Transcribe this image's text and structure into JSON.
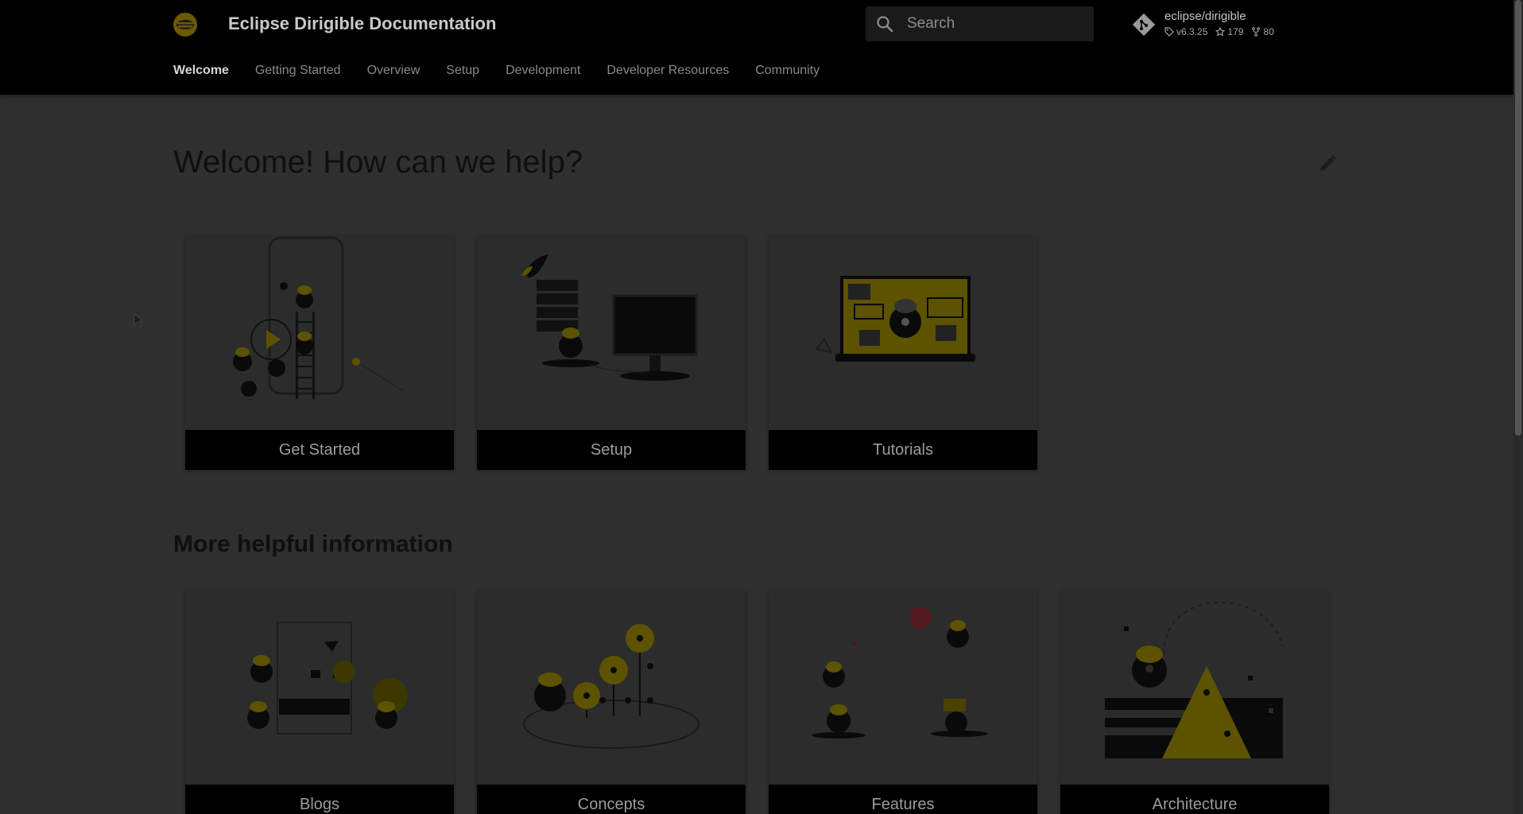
{
  "header": {
    "site_title": "Eclipse Dirigible Documentation",
    "search": {
      "placeholder": "Search"
    },
    "repo": {
      "name": "eclipse/dirigible",
      "version": "v6.3.25",
      "stars": "179",
      "forks": "80"
    },
    "tabs": [
      {
        "label": "Welcome",
        "active": true
      },
      {
        "label": "Getting Started"
      },
      {
        "label": "Overview"
      },
      {
        "label": "Setup"
      },
      {
        "label": "Development"
      },
      {
        "label": "Developer Resources"
      },
      {
        "label": "Community"
      }
    ]
  },
  "main": {
    "title": "Welcome! How can we help?",
    "cards": [
      {
        "label": "Get Started",
        "icon": "get-started-illustration"
      },
      {
        "label": "Setup",
        "icon": "setup-illustration"
      },
      {
        "label": "Tutorials",
        "icon": "tutorials-illustration"
      }
    ],
    "more_title": "More helpful information",
    "more_cards": [
      {
        "label": "Blogs",
        "icon": "blogs-illustration"
      },
      {
        "label": "Concepts",
        "icon": "concepts-illustration"
      },
      {
        "label": "Features",
        "icon": "features-illustration"
      },
      {
        "label": "Architecture",
        "icon": "architecture-illustration"
      }
    ]
  },
  "colors": {
    "header_bg": "#000000",
    "page_bg_dimmed": "#2f2f2f",
    "accent_yellow_dimmed": "#6b6200",
    "button_bg": "#000000"
  }
}
